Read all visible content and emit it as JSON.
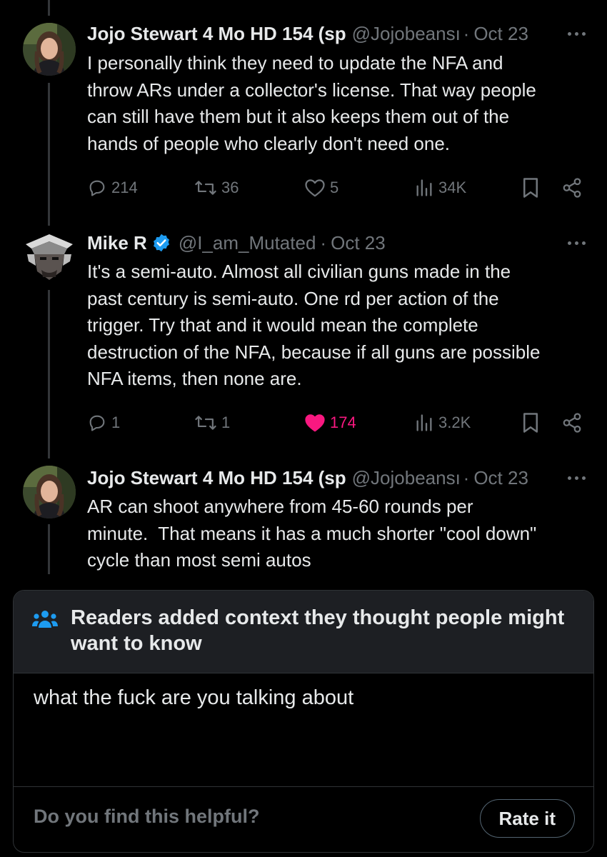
{
  "tweets": [
    {
      "name": "Jojo Stewart 4 Mo HD 154 (sp",
      "handle": "@Jojobeansı",
      "date": "Oct 23",
      "text": "I personally think they need to update the NFA and\nthrow ARs under a collector's license. That way people\ncan still have them but it also keeps them out of the\nhands of people who clearly don't need one.",
      "replies": "214",
      "reposts": "36",
      "likes": "5",
      "views": "34K"
    },
    {
      "name": "Mike R",
      "handle": "@I_am_Mutated",
      "date": "Oct 23",
      "text": "It's a semi-auto. Almost all civilian guns made in the\npast century is semi-auto. One rd per action of the\ntrigger. Try that and it would mean the complete\ndestruction of the NFA, because if all guns are possible\nNFA items, then none are.",
      "replies": "1",
      "reposts": "1",
      "likes": "174",
      "views": "3.2K"
    },
    {
      "name": "Jojo Stewart 4 Mo HD 154 (sp",
      "handle": "@Jojobeansı",
      "date": "Oct 23",
      "text": "AR can shoot anywhere from 45-60 rounds per\nminute.  That means it has a much shorter \"cool down\"\ncycle than most semi autos"
    }
  ],
  "separator": "·",
  "community_note": {
    "title": "Readers added context they thought people might want to know",
    "body": "what the fuck are you talking about",
    "question": "Do you find this helpful?",
    "rate_label": "Rate it"
  },
  "colors": {
    "background": "#000000",
    "text": "#e7e9ea",
    "muted": "#71767b",
    "like": "#f91880",
    "verified": "#1d9bf0",
    "note_header": "#1d1f23"
  },
  "icons": [
    "reply-icon",
    "repost-icon",
    "like-icon",
    "views-icon",
    "bookmark-icon",
    "share-icon",
    "more-icon",
    "verified-icon",
    "community-notes-icon"
  ]
}
